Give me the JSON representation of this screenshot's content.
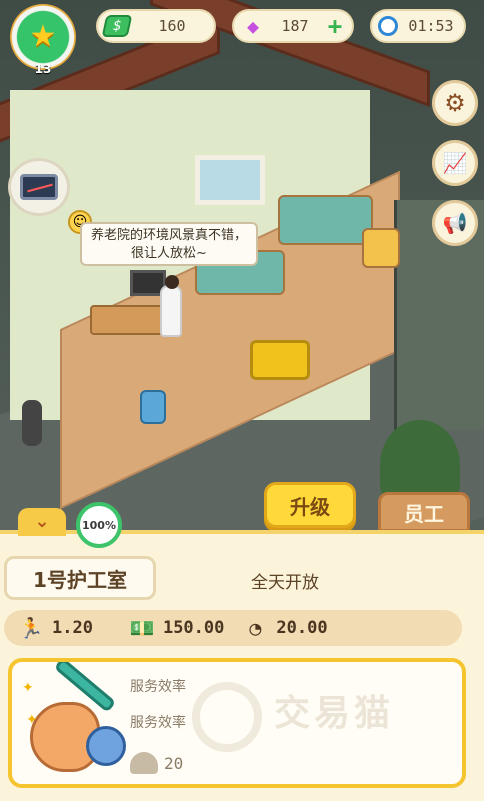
{
  "hud": {
    "level": "13",
    "cash": "160",
    "gems": "187",
    "timer": "01:53"
  },
  "scene": {
    "speech": "养老院的环境风景真不错，很让人放松~"
  },
  "tabs": {
    "upgrade": "升级",
    "staff": "员工"
  },
  "panel": {
    "progress": "100%",
    "room_name": "1号护工室",
    "open_status": "全天开放",
    "stats": {
      "speed": "1.20",
      "income": "150.00",
      "capacity": "20.00"
    },
    "card": {
      "line1": "服务效率",
      "line2": "服务效率",
      "value": "20"
    },
    "watermark": "交易猫"
  },
  "icons": [
    "star-icon",
    "cash-icon",
    "gem-icon",
    "plus-icon",
    "clock-icon",
    "gear-icon",
    "chart-icon",
    "megaphone-icon",
    "chevron-down-icon",
    "running-icon",
    "money-stack-icon",
    "gauge-icon",
    "muscle-icon"
  ],
  "colors": {
    "accent": "#f5c530",
    "progress_ring": "#3dc36a",
    "panel_bg": "#fbf3da"
  }
}
